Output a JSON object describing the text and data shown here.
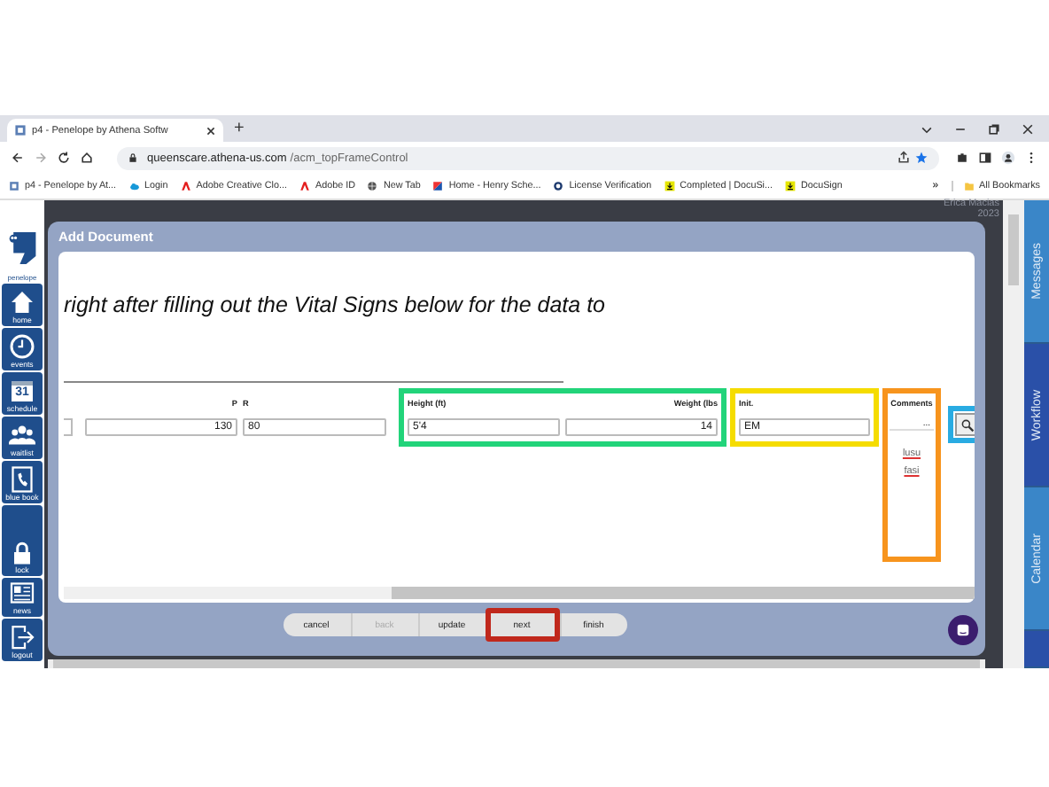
{
  "browser": {
    "tab_title": "p4 - Penelope by Athena Softw",
    "new_tab": "+",
    "url_host": "queenscare.athena-us.com",
    "url_path": "/acm_topFrameControl",
    "bookmarks": [
      {
        "label": "p4 - Penelope by At...",
        "kind": "page"
      },
      {
        "label": "Login",
        "kind": "cloud"
      },
      {
        "label": "Adobe Creative Clo...",
        "kind": "adobe"
      },
      {
        "label": "Adobe ID",
        "kind": "adobe"
      },
      {
        "label": "New Tab",
        "kind": "globe"
      },
      {
        "label": "Home - Henry Sche...",
        "kind": "flag"
      },
      {
        "label": "License Verification",
        "kind": "seal"
      },
      {
        "label": "Completed | DocuSi...",
        "kind": "download"
      },
      {
        "label": "DocuSign",
        "kind": "download"
      }
    ],
    "more": "»",
    "all_bookmarks": "All Bookmarks"
  },
  "logo": "penelope",
  "sidebar": [
    {
      "label": "home",
      "kind": "home"
    },
    {
      "label": "events",
      "kind": "clock"
    },
    {
      "label": "schedule",
      "kind": "calendar",
      "badge": "31"
    },
    {
      "label": "waitlist",
      "kind": "people"
    },
    {
      "label": "blue book",
      "kind": "phone"
    },
    {
      "label": "lock",
      "kind": "lock"
    },
    {
      "label": "news",
      "kind": "news"
    },
    {
      "label": "logout",
      "kind": "logout"
    }
  ],
  "user": {
    "name": "Erica Macias",
    "date": "2023"
  },
  "right_tabs": [
    {
      "label": "Messages",
      "selected": false
    },
    {
      "label": "Workflow",
      "selected": true
    },
    {
      "label": "Calendar",
      "selected": false
    }
  ],
  "dialog": {
    "title": "Add Document",
    "instruction": "right after filling out the Vital Signs below for the data to",
    "groups": [
      {
        "fields": [
          {
            "label": "P",
            "value": "130",
            "right_aligned": true
          },
          {
            "label": "R",
            "value": "80",
            "right_aligned": false
          }
        ]
      },
      {
        "color": "#22d47a",
        "fields": [
          {
            "label": "Height (ft)",
            "value": "5'4",
            "right_aligned": false
          },
          {
            "label": "Weight (lbs",
            "value": "14",
            "right_aligned": true
          }
        ]
      },
      {
        "color": "#f5dc00",
        "fields": [
          {
            "label": "Init.",
            "value": "EM",
            "right_aligned": false
          }
        ]
      }
    ],
    "comments": {
      "label": "Comments",
      "button": "...",
      "text": "lusu fasi",
      "color": "#f7941d"
    },
    "search": {
      "color": "#29abe2"
    },
    "buttons": [
      {
        "label": "cancel",
        "disabled": false
      },
      {
        "label": "back",
        "disabled": true
      },
      {
        "label": "update",
        "disabled": false
      },
      {
        "label": "next",
        "disabled": false,
        "color": "#c0281c"
      },
      {
        "label": "finish",
        "disabled": false
      }
    ]
  }
}
